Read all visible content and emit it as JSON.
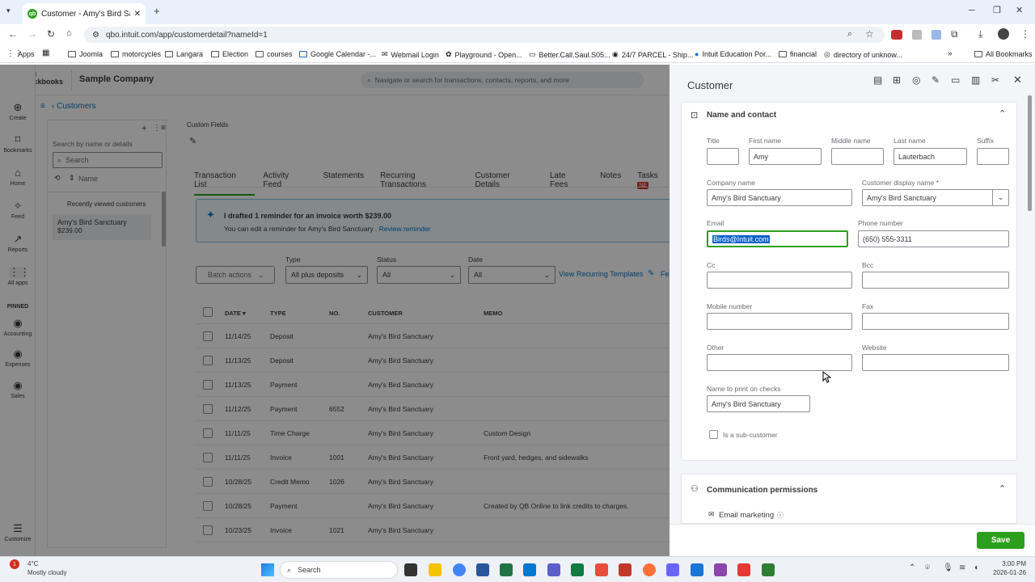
{
  "browser": {
    "tab_title": "Customer - Amy's Bird Sanctu",
    "url": "qbo.intuit.com/app/customerdetail?nameId=1",
    "bookmarks": [
      "Apps",
      "Joomla",
      "motorcycles",
      "Langara",
      "Election",
      "courses",
      "Google Calendar -...",
      "Webmail Login",
      "Playground - Open...",
      "Better.Call.Saul.S05...",
      "24/7 PARCEL - Ship...",
      "Intuit Education Por...",
      "financial",
      "directory of unknow..."
    ],
    "all_bookmarks": "All Bookmarks"
  },
  "app": {
    "logo_line1": "intuit",
    "logo_line2": "quickbooks",
    "company": "Sample Company",
    "search_placeholder": "Navigate or search for transactions, contacts, reports, and more"
  },
  "nav": {
    "items": [
      "Create",
      "Bookmarks",
      "Home",
      "Feed",
      "Reports",
      "All apps"
    ],
    "pinned_label": "PINNED",
    "pinned": [
      "Accounting",
      "Expenses",
      "Sales"
    ],
    "customize": "Customize"
  },
  "customers_list": {
    "back_label": "Customers",
    "search_label": "Search by name or details",
    "search_placeholder": "Search",
    "name_col": "Name",
    "recent_header": "Recently viewed customers",
    "recent": [
      {
        "name": "Amy's Bird Sanctuary",
        "balance": "$239.00"
      }
    ]
  },
  "detail": {
    "custom_fields": "Custom Fields",
    "tabs": [
      "Transaction List",
      "Activity Feed",
      "Statements",
      "Recurring Transactions",
      "Customer Details",
      "Late Fees",
      "Notes",
      "Tasks"
    ],
    "tasks_badge": "NE",
    "banner_title": "I drafted 1 reminder for an invoice worth $239.00",
    "banner_sub": "You can edit a reminder for Amy's Bird Sanctuary .",
    "banner_link": "Review reminder",
    "batch_actions": "Batch actions",
    "filters": {
      "type_label": "Type",
      "type_value": "All plus deposits",
      "status_label": "Status",
      "status_value": "All",
      "date_label": "Date",
      "date_value": "All"
    },
    "view_recurring": "View Recurring Templates",
    "fee_cut": "Fe",
    "columns": [
      "DATE ▾",
      "TYPE",
      "NO.",
      "CUSTOMER",
      "MEMO"
    ],
    "rows": [
      {
        "date": "11/14/25",
        "type": "Deposit",
        "no": "",
        "customer": "Amy's Bird Sanctuary",
        "memo": ""
      },
      {
        "date": "11/13/25",
        "type": "Deposit",
        "no": "",
        "customer": "Amy's Bird Sanctuary",
        "memo": ""
      },
      {
        "date": "11/13/25",
        "type": "Payment",
        "no": "",
        "customer": "Amy's Bird Sanctuary",
        "memo": ""
      },
      {
        "date": "11/12/25",
        "type": "Payment",
        "no": "6552",
        "customer": "Amy's Bird Sanctuary",
        "memo": ""
      },
      {
        "date": "11/11/25",
        "type": "Time Charge",
        "no": "",
        "customer": "Amy's Bird Sanctuary",
        "memo": "Custom Design"
      },
      {
        "date": "11/11/25",
        "type": "Invoice",
        "no": "1001",
        "customer": "Amy's Bird Sanctuary",
        "memo": "Front yard, hedges, and sidewalks"
      },
      {
        "date": "10/28/25",
        "type": "Credit Memo",
        "no": "1026",
        "customer": "Amy's Bird Sanctuary",
        "memo": ""
      },
      {
        "date": "10/28/25",
        "type": "Payment",
        "no": "",
        "customer": "Amy's Bird Sanctuary",
        "memo": "Created by QB Online to link credits to charges."
      },
      {
        "date": "10/23/25",
        "type": "Invoice",
        "no": "1021",
        "customer": "Amy's Bird Sanctuary",
        "memo": ""
      }
    ]
  },
  "panel": {
    "title": "Customer",
    "section_title": "Name and contact",
    "title_label": "Title",
    "title_value": "",
    "first_label": "First name",
    "first_value": "Amy",
    "middle_label": "Middle name",
    "middle_value": "",
    "last_label": "Last name",
    "last_value": "Lauterbach",
    "suffix_label": "Suffix",
    "suffix_value": "",
    "company_label": "Company name",
    "company_value": "Amy's Bird Sanctuary",
    "display_label": "Customer display name *",
    "display_value": "Amy's Bird Sanctuary",
    "email_label": "Email",
    "email_value": "Birds@Intuit.com",
    "phone_label": "Phone number",
    "phone_value": "(650) 555-3311",
    "cc_label": "Cc",
    "bcc_label": "Bcc",
    "mobile_label": "Mobile number",
    "fax_label": "Fax",
    "other_label": "Other",
    "website_label": "Website",
    "print_label": "Name to print on checks",
    "print_value": "Amy's Bird Sanctuary",
    "sub_customer": "Is a sub-customer",
    "comm_title": "Communication permissions",
    "email_marketing": "Email marketing",
    "save": "Save"
  },
  "taskbar": {
    "temp": "4°C",
    "weather": "Mostly cloudy",
    "search": "Search",
    "time": "3:00 PM",
    "date": "2026-01-26"
  },
  "colors": {
    "accent": "#2ca01c",
    "link": "#0077c5",
    "select": "#0a61c9"
  }
}
